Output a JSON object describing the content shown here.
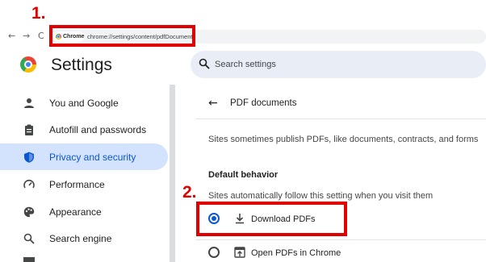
{
  "browser": {
    "back_icon": "←",
    "forward_icon": "→",
    "reload_icon": "C",
    "chip_label": "Chrome",
    "url": "chrome://settings/content/pdfDocuments"
  },
  "annotations": {
    "label_1": "1.",
    "label_2": "2.",
    "color": "#e00000"
  },
  "header": {
    "title": "Settings",
    "search_placeholder": "Search settings"
  },
  "sidebar": {
    "items": [
      {
        "label": "You and Google",
        "icon": "person-icon"
      },
      {
        "label": "Autofill and passwords",
        "icon": "clipboard-icon"
      },
      {
        "label": "Privacy and security",
        "icon": "shield-icon",
        "active": true
      },
      {
        "label": "Performance",
        "icon": "speedometer-icon"
      },
      {
        "label": "Appearance",
        "icon": "palette-icon"
      },
      {
        "label": "Search engine",
        "icon": "search-icon"
      }
    ]
  },
  "main": {
    "back_icon": "←",
    "title": "PDF documents",
    "description": "Sites sometimes publish PDFs, like documents, contracts, and forms",
    "section_title": "Default behavior",
    "section_subtitle": "Sites automatically follow this setting when you visit them",
    "options": [
      {
        "label": "Download PDFs",
        "icon": "download-icon",
        "selected": true
      },
      {
        "label": "Open PDFs in Chrome",
        "icon": "open-in-browser-icon",
        "selected": false
      }
    ]
  },
  "colors": {
    "accent": "#0b57d0",
    "active_bg": "#d3e3fd",
    "search_bg": "#e9eef6"
  }
}
